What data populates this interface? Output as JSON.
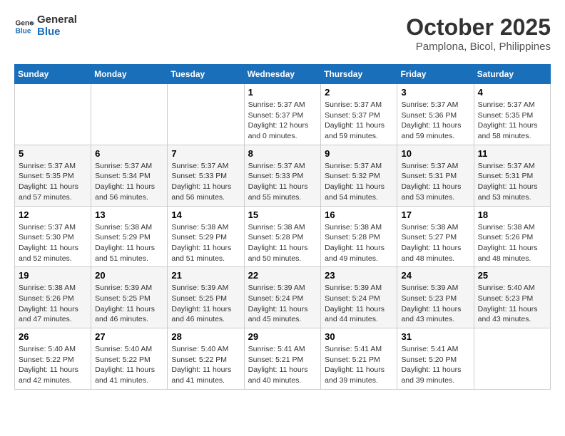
{
  "header": {
    "logo_line1": "General",
    "logo_line2": "Blue",
    "month": "October 2025",
    "location": "Pamplona, Bicol, Philippines"
  },
  "days_of_week": [
    "Sunday",
    "Monday",
    "Tuesday",
    "Wednesday",
    "Thursday",
    "Friday",
    "Saturday"
  ],
  "weeks": [
    [
      {
        "day": "",
        "sunrise": "",
        "sunset": "",
        "daylight": ""
      },
      {
        "day": "",
        "sunrise": "",
        "sunset": "",
        "daylight": ""
      },
      {
        "day": "",
        "sunrise": "",
        "sunset": "",
        "daylight": ""
      },
      {
        "day": "1",
        "sunrise": "Sunrise: 5:37 AM",
        "sunset": "Sunset: 5:37 PM",
        "daylight": "Daylight: 12 hours and 0 minutes."
      },
      {
        "day": "2",
        "sunrise": "Sunrise: 5:37 AM",
        "sunset": "Sunset: 5:37 PM",
        "daylight": "Daylight: 11 hours and 59 minutes."
      },
      {
        "day": "3",
        "sunrise": "Sunrise: 5:37 AM",
        "sunset": "Sunset: 5:36 PM",
        "daylight": "Daylight: 11 hours and 59 minutes."
      },
      {
        "day": "4",
        "sunrise": "Sunrise: 5:37 AM",
        "sunset": "Sunset: 5:35 PM",
        "daylight": "Daylight: 11 hours and 58 minutes."
      }
    ],
    [
      {
        "day": "5",
        "sunrise": "Sunrise: 5:37 AM",
        "sunset": "Sunset: 5:35 PM",
        "daylight": "Daylight: 11 hours and 57 minutes."
      },
      {
        "day": "6",
        "sunrise": "Sunrise: 5:37 AM",
        "sunset": "Sunset: 5:34 PM",
        "daylight": "Daylight: 11 hours and 56 minutes."
      },
      {
        "day": "7",
        "sunrise": "Sunrise: 5:37 AM",
        "sunset": "Sunset: 5:33 PM",
        "daylight": "Daylight: 11 hours and 56 minutes."
      },
      {
        "day": "8",
        "sunrise": "Sunrise: 5:37 AM",
        "sunset": "Sunset: 5:33 PM",
        "daylight": "Daylight: 11 hours and 55 minutes."
      },
      {
        "day": "9",
        "sunrise": "Sunrise: 5:37 AM",
        "sunset": "Sunset: 5:32 PM",
        "daylight": "Daylight: 11 hours and 54 minutes."
      },
      {
        "day": "10",
        "sunrise": "Sunrise: 5:37 AM",
        "sunset": "Sunset: 5:31 PM",
        "daylight": "Daylight: 11 hours and 53 minutes."
      },
      {
        "day": "11",
        "sunrise": "Sunrise: 5:37 AM",
        "sunset": "Sunset: 5:31 PM",
        "daylight": "Daylight: 11 hours and 53 minutes."
      }
    ],
    [
      {
        "day": "12",
        "sunrise": "Sunrise: 5:37 AM",
        "sunset": "Sunset: 5:30 PM",
        "daylight": "Daylight: 11 hours and 52 minutes."
      },
      {
        "day": "13",
        "sunrise": "Sunrise: 5:38 AM",
        "sunset": "Sunset: 5:29 PM",
        "daylight": "Daylight: 11 hours and 51 minutes."
      },
      {
        "day": "14",
        "sunrise": "Sunrise: 5:38 AM",
        "sunset": "Sunset: 5:29 PM",
        "daylight": "Daylight: 11 hours and 51 minutes."
      },
      {
        "day": "15",
        "sunrise": "Sunrise: 5:38 AM",
        "sunset": "Sunset: 5:28 PM",
        "daylight": "Daylight: 11 hours and 50 minutes."
      },
      {
        "day": "16",
        "sunrise": "Sunrise: 5:38 AM",
        "sunset": "Sunset: 5:28 PM",
        "daylight": "Daylight: 11 hours and 49 minutes."
      },
      {
        "day": "17",
        "sunrise": "Sunrise: 5:38 AM",
        "sunset": "Sunset: 5:27 PM",
        "daylight": "Daylight: 11 hours and 48 minutes."
      },
      {
        "day": "18",
        "sunrise": "Sunrise: 5:38 AM",
        "sunset": "Sunset: 5:26 PM",
        "daylight": "Daylight: 11 hours and 48 minutes."
      }
    ],
    [
      {
        "day": "19",
        "sunrise": "Sunrise: 5:38 AM",
        "sunset": "Sunset: 5:26 PM",
        "daylight": "Daylight: 11 hours and 47 minutes."
      },
      {
        "day": "20",
        "sunrise": "Sunrise: 5:39 AM",
        "sunset": "Sunset: 5:25 PM",
        "daylight": "Daylight: 11 hours and 46 minutes."
      },
      {
        "day": "21",
        "sunrise": "Sunrise: 5:39 AM",
        "sunset": "Sunset: 5:25 PM",
        "daylight": "Daylight: 11 hours and 46 minutes."
      },
      {
        "day": "22",
        "sunrise": "Sunrise: 5:39 AM",
        "sunset": "Sunset: 5:24 PM",
        "daylight": "Daylight: 11 hours and 45 minutes."
      },
      {
        "day": "23",
        "sunrise": "Sunrise: 5:39 AM",
        "sunset": "Sunset: 5:24 PM",
        "daylight": "Daylight: 11 hours and 44 minutes."
      },
      {
        "day": "24",
        "sunrise": "Sunrise: 5:39 AM",
        "sunset": "Sunset: 5:23 PM",
        "daylight": "Daylight: 11 hours and 43 minutes."
      },
      {
        "day": "25",
        "sunrise": "Sunrise: 5:40 AM",
        "sunset": "Sunset: 5:23 PM",
        "daylight": "Daylight: 11 hours and 43 minutes."
      }
    ],
    [
      {
        "day": "26",
        "sunrise": "Sunrise: 5:40 AM",
        "sunset": "Sunset: 5:22 PM",
        "daylight": "Daylight: 11 hours and 42 minutes."
      },
      {
        "day": "27",
        "sunrise": "Sunrise: 5:40 AM",
        "sunset": "Sunset: 5:22 PM",
        "daylight": "Daylight: 11 hours and 41 minutes."
      },
      {
        "day": "28",
        "sunrise": "Sunrise: 5:40 AM",
        "sunset": "Sunset: 5:22 PM",
        "daylight": "Daylight: 11 hours and 41 minutes."
      },
      {
        "day": "29",
        "sunrise": "Sunrise: 5:41 AM",
        "sunset": "Sunset: 5:21 PM",
        "daylight": "Daylight: 11 hours and 40 minutes."
      },
      {
        "day": "30",
        "sunrise": "Sunrise: 5:41 AM",
        "sunset": "Sunset: 5:21 PM",
        "daylight": "Daylight: 11 hours and 39 minutes."
      },
      {
        "day": "31",
        "sunrise": "Sunrise: 5:41 AM",
        "sunset": "Sunset: 5:20 PM",
        "daylight": "Daylight: 11 hours and 39 minutes."
      },
      {
        "day": "",
        "sunrise": "",
        "sunset": "",
        "daylight": ""
      }
    ]
  ]
}
